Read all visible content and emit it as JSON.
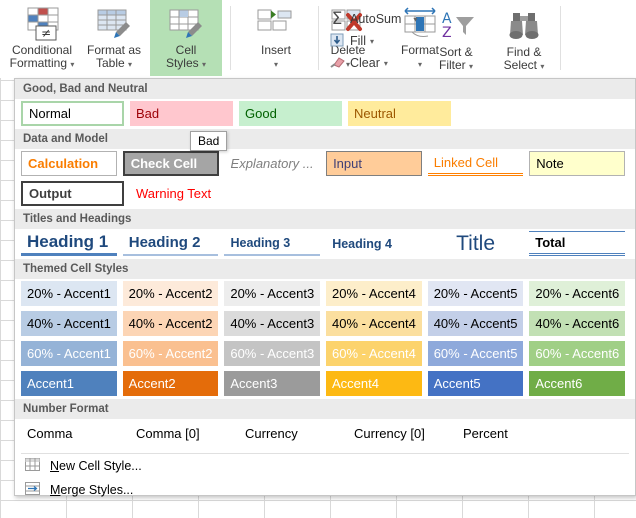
{
  "ribbon": {
    "buttons": [
      {
        "label1": "Conditional",
        "label2": "Formatting",
        "icon": "conditional-formatting-icon",
        "selected": false,
        "caret": "▾"
      },
      {
        "label1": "Format as",
        "label2": "Table",
        "icon": "format-as-table-icon",
        "selected": false,
        "caret": "▾"
      },
      {
        "label1": "Cell",
        "label2": "Styles",
        "icon": "cell-styles-icon",
        "selected": true,
        "caret": "▾"
      },
      {
        "label1": "Insert",
        "label2": "",
        "icon": "insert-cells-icon",
        "selected": false,
        "caret": "▾"
      },
      {
        "label1": "Delete",
        "label2": "",
        "icon": "delete-cells-icon",
        "selected": false,
        "caret": "▾"
      },
      {
        "label1": "Format",
        "label2": "",
        "icon": "format-cells-icon",
        "selected": false,
        "caret": "▾"
      }
    ],
    "editing": {
      "autosum": "AutoSum",
      "fill": "Fill",
      "clear": "Clear",
      "sort_filter1": "Sort &",
      "sort_filter2": "Filter",
      "find_select1": "Find &",
      "find_select2": "Select",
      "caret": "▾"
    }
  },
  "tooltip": {
    "text": "Bad"
  },
  "gallery": {
    "sections": [
      {
        "heading": "Good, Bad and Neutral",
        "rows": [
          [
            {
              "label": "Normal",
              "style": "st-normal",
              "name": "style-normal"
            },
            {
              "label": "Bad",
              "style": "st-bad",
              "name": "style-bad"
            },
            {
              "label": "Good",
              "style": "st-good",
              "name": "style-good"
            },
            {
              "label": "Neutral",
              "style": "st-neutral",
              "name": "style-neutral"
            }
          ]
        ]
      },
      {
        "heading": "Data and Model",
        "rows": [
          [
            {
              "label": "Calculation",
              "style": "st-calc",
              "name": "style-calculation"
            },
            {
              "label": "Check Cell",
              "style": "st-check",
              "name": "style-check-cell"
            },
            {
              "label": "Explanatory ...",
              "style": "st-expl",
              "name": "style-explanatory-text"
            },
            {
              "label": "Input",
              "style": "st-input",
              "name": "style-input"
            },
            {
              "label": "Linked Cell",
              "style": "st-linked",
              "name": "style-linked-cell"
            },
            {
              "label": "Note",
              "style": "st-note",
              "name": "style-note"
            }
          ],
          [
            {
              "label": "Output",
              "style": "st-output",
              "name": "style-output"
            },
            {
              "label": "Warning Text",
              "style": "st-warn",
              "name": "style-warning-text"
            }
          ]
        ]
      },
      {
        "heading": "Titles and Headings",
        "rows": [
          [
            {
              "label": "Heading 1",
              "style": "st-h1",
              "name": "style-heading-1"
            },
            {
              "label": "Heading 2",
              "style": "st-h2",
              "name": "style-heading-2"
            },
            {
              "label": "Heading 3",
              "style": "st-h3",
              "name": "style-heading-3"
            },
            {
              "label": "Heading 4",
              "style": "st-h4",
              "name": "style-heading-4"
            },
            {
              "label": "Title",
              "style": "st-title",
              "name": "style-title"
            },
            {
              "label": "Total",
              "style": "st-total",
              "name": "style-total"
            }
          ]
        ]
      },
      {
        "heading": "Themed Cell Styles",
        "rows": [
          [
            {
              "label": "20% - Accent1",
              "style": "a20-1",
              "name": "style-20-accent1"
            },
            {
              "label": "20% - Accent2",
              "style": "a20-2",
              "name": "style-20-accent2"
            },
            {
              "label": "20% - Accent3",
              "style": "a20-3",
              "name": "style-20-accent3"
            },
            {
              "label": "20% - Accent4",
              "style": "a20-4",
              "name": "style-20-accent4"
            },
            {
              "label": "20% - Accent5",
              "style": "a20-5",
              "name": "style-20-accent5"
            },
            {
              "label": "20% - Accent6",
              "style": "a20-6",
              "name": "style-20-accent6"
            }
          ],
          [
            {
              "label": "40% - Accent1",
              "style": "a40-1",
              "name": "style-40-accent1"
            },
            {
              "label": "40% - Accent2",
              "style": "a40-2",
              "name": "style-40-accent2"
            },
            {
              "label": "40% - Accent3",
              "style": "a40-3",
              "name": "style-40-accent3"
            },
            {
              "label": "40% - Accent4",
              "style": "a40-4",
              "name": "style-40-accent4"
            },
            {
              "label": "40% - Accent5",
              "style": "a40-5",
              "name": "style-40-accent5"
            },
            {
              "label": "40% - Accent6",
              "style": "a40-6",
              "name": "style-40-accent6"
            }
          ],
          [
            {
              "label": "60% - Accent1",
              "style": "a60-1",
              "name": "style-60-accent1"
            },
            {
              "label": "60% - Accent2",
              "style": "a60-2",
              "name": "style-60-accent2"
            },
            {
              "label": "60% - Accent3",
              "style": "a60-3",
              "name": "style-60-accent3"
            },
            {
              "label": "60% - Accent4",
              "style": "a60-4",
              "name": "style-60-accent4"
            },
            {
              "label": "60% - Accent5",
              "style": "a60-5",
              "name": "style-60-accent5"
            },
            {
              "label": "60% - Accent6",
              "style": "a60-6",
              "name": "style-60-accent6"
            }
          ],
          [
            {
              "label": "Accent1",
              "style": "a100-1",
              "name": "style-accent1"
            },
            {
              "label": "Accent2",
              "style": "a100-2",
              "name": "style-accent2"
            },
            {
              "label": "Accent3",
              "style": "a100-3",
              "name": "style-accent3"
            },
            {
              "label": "Accent4",
              "style": "a100-4",
              "name": "style-accent4"
            },
            {
              "label": "Accent5",
              "style": "a100-5",
              "name": "style-accent5"
            },
            {
              "label": "Accent6",
              "style": "a100-6",
              "name": "style-accent6"
            }
          ]
        ]
      },
      {
        "heading": "Number Format",
        "rows": [
          [
            {
              "label": "Comma",
              "style": "st-num",
              "name": "style-comma"
            },
            {
              "label": "Comma [0]",
              "style": "st-num",
              "name": "style-comma-0"
            },
            {
              "label": "Currency",
              "style": "st-num",
              "name": "style-currency"
            },
            {
              "label": "Currency [0]",
              "style": "st-num",
              "name": "style-currency-0"
            },
            {
              "label": "Percent",
              "style": "st-num",
              "name": "style-percent"
            }
          ]
        ]
      }
    ],
    "commands": [
      {
        "accel": "N",
        "rest": "ew Cell Style...",
        "icon": "new-cell-style-icon",
        "name": "new-cell-style-command"
      },
      {
        "accel": "M",
        "rest": "erge Styles...",
        "icon": "merge-styles-icon",
        "name": "merge-styles-command"
      }
    ]
  }
}
